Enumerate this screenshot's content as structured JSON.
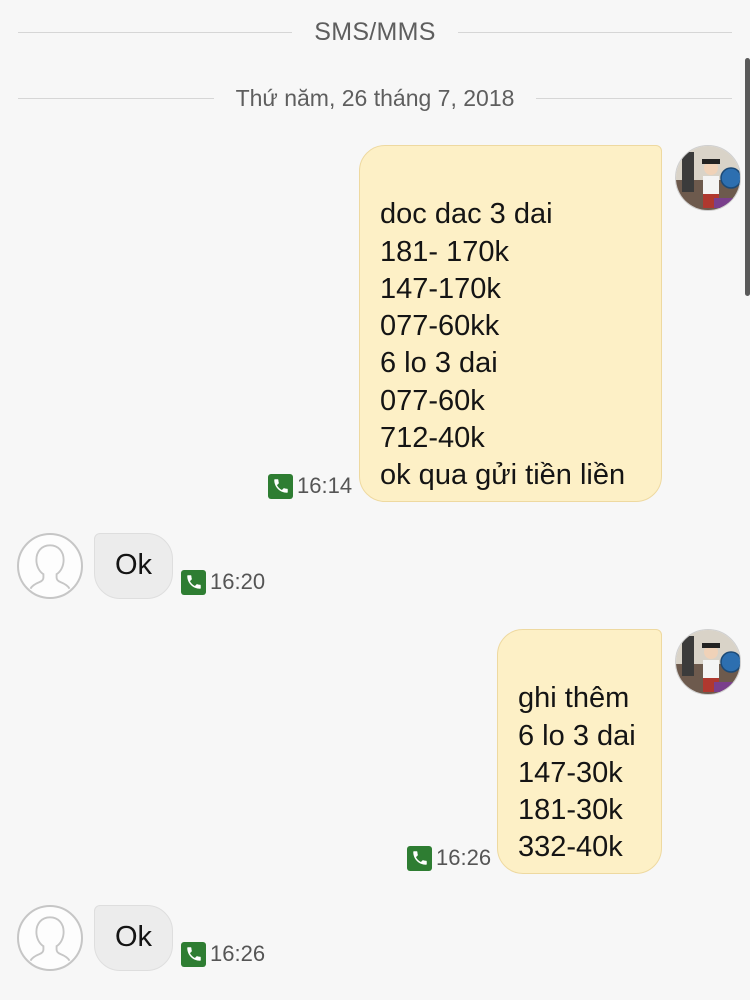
{
  "header": {
    "title": "SMS/MMS"
  },
  "date_divider": "Thứ năm, 26 tháng 7, 2018",
  "messages": [
    {
      "direction": "outgoing",
      "text": "doc dac 3 dai\n181- 170k\n147-170k\n077-60kk\n6 lo 3 dai\n077-60k\n712-40k\nok qua gửi tiền liền",
      "time": "16:14",
      "avatar": "contact-photo",
      "status_icon": "call-icon"
    },
    {
      "direction": "incoming",
      "text": "Ok",
      "time": "16:20",
      "avatar": "default-person-icon",
      "status_icon": "call-icon"
    },
    {
      "direction": "outgoing",
      "text": "ghi thêm\n6 lo 3 dai\n147-30k\n181-30k\n332-40k",
      "time": "16:26",
      "avatar": "contact-photo",
      "status_icon": "call-icon"
    },
    {
      "direction": "incoming",
      "text": "Ok",
      "time": "16:26",
      "avatar": "default-person-icon",
      "status_icon": "call-icon"
    }
  ],
  "colors": {
    "background": "#f7f7f7",
    "outgoing_bubble": "#fdf0c6",
    "incoming_bubble": "#ececec",
    "call_icon": "#2e7d32",
    "divider_text": "#5e5e5e"
  }
}
